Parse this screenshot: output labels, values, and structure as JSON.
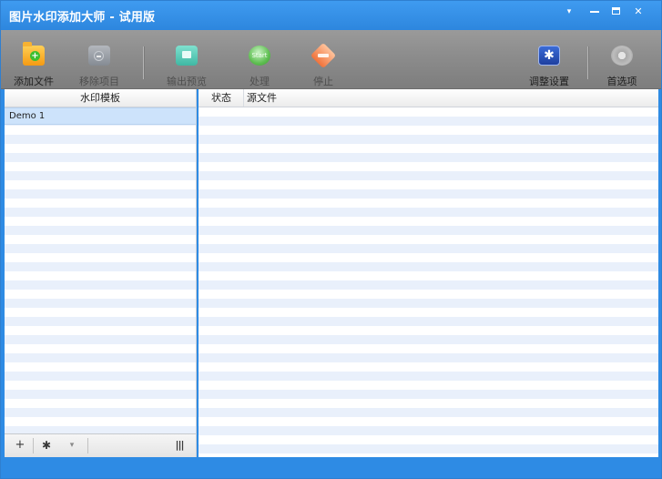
{
  "window": {
    "title": "图片水印添加大师 - 试用版",
    "controls": {
      "menu": "▾",
      "close": "✕"
    }
  },
  "toolbar": {
    "add_files": "添加文件",
    "remove_item": "移除项目",
    "export_preview": "输出预览",
    "process": "处理",
    "process_icon_text": "Start",
    "stop": "停止",
    "adjust_settings": "调整设置",
    "preferences": "首选项"
  },
  "left_panel": {
    "header": "水印模板",
    "templates": [
      "Demo 1"
    ],
    "footer": {
      "add": "+",
      "settings": "✱",
      "dropdown": "▾",
      "columns": "|||"
    }
  },
  "right_panel": {
    "columns": [
      "状态",
      "源文件"
    ]
  },
  "colors": {
    "titlebar": "#2e8be4",
    "toolbar": "#8c8c8c",
    "row_alt": "#e9f0fb",
    "selection": "#cde3fb"
  }
}
